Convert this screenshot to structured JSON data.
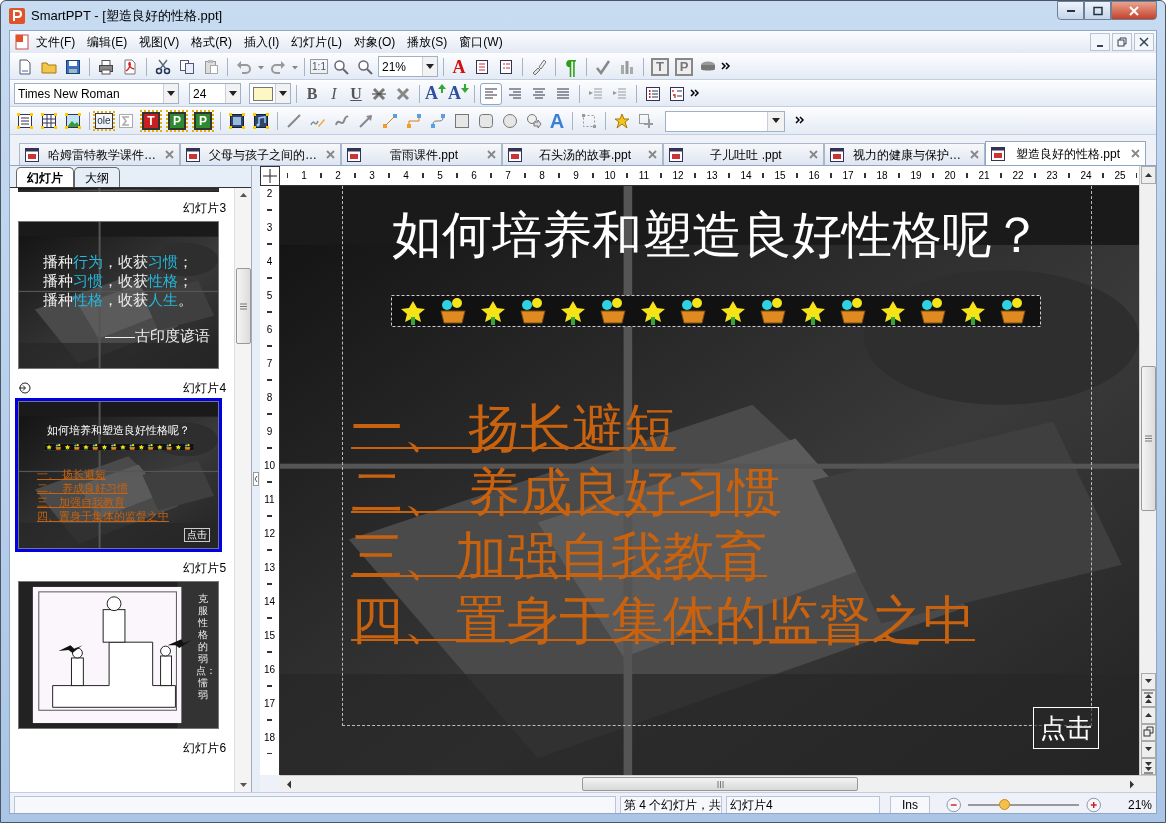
{
  "window": {
    "title": "SmartPPT - [塑造良好的性格.ppt]"
  },
  "menu": [
    "文件(F)",
    "编辑(E)",
    "视图(V)",
    "格式(R)",
    "插入(I)",
    "幻灯片(L)",
    "对象(O)",
    "播放(S)",
    "窗口(W)"
  ],
  "standard_toolbar": {
    "actual_size_button": "1:1",
    "zoom": "21%",
    "text_color_button": "A",
    "pilcrow_button": "¶",
    "placeholder_buttons": [
      "T",
      "P"
    ]
  },
  "format_toolbar": {
    "font": "Times New Roman",
    "size": "24",
    "style_buttons": [
      "B",
      "I",
      "U"
    ],
    "font_size_buttons": [
      "A",
      "A"
    ],
    "align_buttons": [
      {
        "selected": true
      },
      {
        "selected": false
      },
      {
        "selected": false
      },
      {
        "selected": false
      }
    ]
  },
  "drawing_toolbar": {
    "ole_button": "ole",
    "frame_buttons": [
      "T",
      "P",
      "P"
    ],
    "wordart_button": "A"
  },
  "document_tabs": [
    {
      "label": "哈姆雷特教学课件…",
      "selected": false
    },
    {
      "label": "父母与孩子之间的…",
      "selected": false
    },
    {
      "label": "雷雨课件.ppt",
      "selected": false
    },
    {
      "label": "石头汤的故事.ppt",
      "selected": false
    },
    {
      "label": "子儿吐吐 .ppt",
      "selected": false
    },
    {
      "label": "视力的健康与保护…",
      "selected": false
    },
    {
      "label": "塑造良好的性格.ppt",
      "selected": true
    }
  ],
  "panel_tabs": [
    {
      "label": "幻灯片",
      "selected": true
    },
    {
      "label": "大纲",
      "selected": false
    }
  ],
  "thumbnails": [
    {
      "kind": "clipped",
      "selected": false
    },
    {
      "kind": "quote",
      "label": "幻灯片3",
      "selected": false,
      "transition": false,
      "lines": [
        [
          {
            "text": "播种",
            "highlight": false
          },
          {
            "text": "行为",
            "highlight": true
          },
          {
            "text": "，收获",
            "highlight": false
          },
          {
            "text": "习惯",
            "highlight": true
          },
          {
            "text": "；",
            "highlight": false
          }
        ],
        [
          {
            "text": "播种",
            "highlight": false
          },
          {
            "text": "习惯",
            "highlight": true
          },
          {
            "text": "，收获",
            "highlight": false
          },
          {
            "text": "性格",
            "highlight": true
          },
          {
            "text": "；",
            "highlight": false
          }
        ],
        [
          {
            "text": "播种",
            "highlight": false
          },
          {
            "text": "性格",
            "highlight": true
          },
          {
            "text": "，收获",
            "highlight": false
          },
          {
            "text": "人生",
            "highlight": true
          },
          {
            "text": "。",
            "highlight": false
          }
        ]
      ],
      "attribution": "——古印度谚语"
    },
    {
      "kind": "menu",
      "label": "幻灯片4",
      "selected": true,
      "transition": true,
      "title": "如何培养和塑造良好性格呢？",
      "links": [
        "一、 扬长避短",
        "二、 养成良好习惯",
        "三、加强自我教育",
        "四、置身于集体的监督之中"
      ],
      "button": "点击"
    },
    {
      "kind": "cartoon",
      "label": "幻灯片5",
      "selected": false,
      "transition": false,
      "caption": "克服性格的弱点：懦弱"
    },
    {
      "kind": "offscreen",
      "label": "幻灯片6",
      "selected": false,
      "transition": false
    }
  ],
  "rulers": {
    "horizontal": [
      "1",
      "2",
      "3",
      "4",
      "5",
      "6",
      "7",
      "8",
      "9",
      "10",
      "11",
      "12",
      "13",
      "14",
      "15",
      "16",
      "17",
      "18",
      "19",
      "20",
      "21",
      "22",
      "23",
      "24",
      "25"
    ],
    "vertical": [
      "2",
      "3",
      "4",
      "5",
      "6",
      "7",
      "8",
      "9",
      "10",
      "11",
      "12",
      "13",
      "14",
      "15",
      "16",
      "17",
      "18"
    ]
  },
  "slide": {
    "title": "如何培养和塑造良好性格呢？",
    "links": [
      "一、 扬长避短",
      "二、 养成良好习惯",
      "三、加强自我教育",
      "四、置身于集体的监督之中"
    ],
    "button": "点击"
  },
  "status_bar": {
    "fields": [
      "第 4 个幻灯片，共",
      "幻灯片4",
      "Ins"
    ],
    "zoom_slider": {
      "level": 0.32
    },
    "zoom_reading": "21%"
  }
}
